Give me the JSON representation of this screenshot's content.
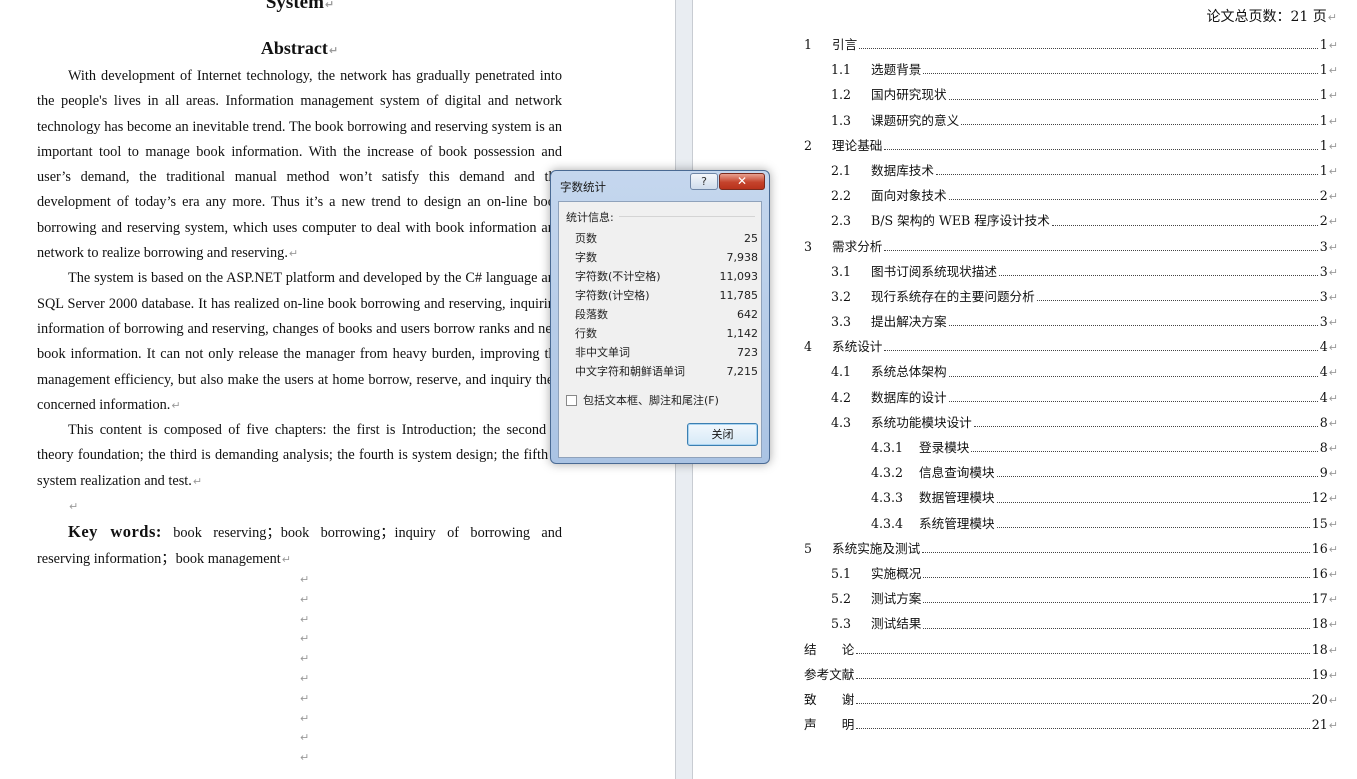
{
  "left_page": {
    "doc_title": "System",
    "abstract_title": "Abstract",
    "para_mark": "↵",
    "paragraphs": [
      "With development of Internet technology, the network has gradually penetrated into the people's lives in all areas. Information management system of digital and network technology has become an inevitable trend. The book borrowing and reserving system is an important tool to manage book information. With the increase of book possession and user’s demand, the traditional manual method won’t satisfy this demand and the development of today’s era any more. Thus it’s a new trend to design an on-line book borrowing and reserving system, which uses computer to deal with book information and network to realize borrowing and reserving.",
      "The system is based on the ASP.NET platform and developed by the C# language and SQL Server 2000 database. It has realized on-line book borrowing and reserving, inquiring information of borrowing and reserving, changes of books and users borrow ranks and new book information. It can not only release the manager from heavy burden, improving the management efficiency, but also make the users at home borrow, reserve, and inquiry their concerned information.",
      "This content is composed of five chapters: the first is Introduction; the second is theory foundation; the third is demanding analysis; the fourth is system design; the fifth is system realization and test."
    ],
    "keywords_label": "Key words:",
    "keywords_text": " book reserving；book borrowing；inquiry of borrowing and reserving information；book management"
  },
  "right_page": {
    "total_pages": "论文总页数：21 页",
    "toc": [
      {
        "num": "1",
        "title": "引言",
        "page": "1",
        "level": 1
      },
      {
        "num": "1.1",
        "title": "选题背景",
        "page": "1",
        "level": 2
      },
      {
        "num": "1.2",
        "title": "国内研究现状",
        "page": "1",
        "level": 2
      },
      {
        "num": "1.3",
        "title": "课题研究的意义",
        "page": "1",
        "level": 2
      },
      {
        "num": "2",
        "title": "理论基础",
        "page": "1",
        "level": 1
      },
      {
        "num": "2.1",
        "title": "数据库技术",
        "page": "1",
        "level": 2
      },
      {
        "num": "2.2",
        "title": "面向对象技术",
        "page": "2",
        "level": 2
      },
      {
        "num": "2.3",
        "title": "B/S 架构的 WEB 程序设计技术",
        "page": "2",
        "level": 2
      },
      {
        "num": "3",
        "title": "需求分析",
        "page": "3",
        "level": 1
      },
      {
        "num": "3.1",
        "title": "图书订阅系统现状描述",
        "page": "3",
        "level": 2
      },
      {
        "num": "3.2",
        "title": "现行系统存在的主要问题分析",
        "page": "3",
        "level": 2
      },
      {
        "num": "3.3",
        "title": "提出解决方案",
        "page": "3",
        "level": 2
      },
      {
        "num": "4",
        "title": "系统设计",
        "page": "4",
        "level": 1
      },
      {
        "num": "4.1",
        "title": "系统总体架构",
        "page": "4",
        "level": 2
      },
      {
        "num": "4.2",
        "title": "数据库的设计",
        "page": "4",
        "level": 2
      },
      {
        "num": "4.3",
        "title": "系统功能模块设计",
        "page": "8",
        "level": 2
      },
      {
        "num": "4.3.1",
        "title": "登录模块",
        "page": "8",
        "level": 3
      },
      {
        "num": "4.3.2",
        "title": "信息查询模块",
        "page": "9",
        "level": 3
      },
      {
        "num": "4.3.3",
        "title": "数据管理模块",
        "page": "12",
        "level": 3
      },
      {
        "num": "4.3.4",
        "title": "系统管理模块",
        "page": "15",
        "level": 3
      },
      {
        "num": "5",
        "title": "系统实施及测试",
        "page": "16",
        "level": 1
      },
      {
        "num": "5.1",
        "title": "实施概况",
        "page": "16",
        "level": 2
      },
      {
        "num": "5.2",
        "title": "测试方案",
        "page": "17",
        "level": 2
      },
      {
        "num": "5.3",
        "title": "测试结果",
        "page": "18",
        "level": 2
      },
      {
        "num": "",
        "title": "结　　论",
        "page": "18",
        "level": 0
      },
      {
        "num": "",
        "title": "参考文献",
        "page": "19",
        "level": 0
      },
      {
        "num": "",
        "title": "致　　谢",
        "page": "20",
        "level": 0
      },
      {
        "num": "",
        "title": "声　　明",
        "page": "21",
        "level": 0
      }
    ]
  },
  "dialog": {
    "title": "字数统计",
    "help": "?",
    "close_x": "✕",
    "section_label": "统计信息:",
    "stats": [
      {
        "label": "页数",
        "value": "25"
      },
      {
        "label": "字数",
        "value": "7,938"
      },
      {
        "label": "字符数(不计空格)",
        "value": "11,093"
      },
      {
        "label": "字符数(计空格)",
        "value": "11,785"
      },
      {
        "label": "段落数",
        "value": "642"
      },
      {
        "label": "行数",
        "value": "1,142"
      },
      {
        "label": "非中文单词",
        "value": "723"
      },
      {
        "label": "中文字符和朝鲜语单词",
        "value": "7,215"
      }
    ],
    "checkbox_label": "包括文本框、脚注和尾注(F)",
    "close_button": "关闭"
  }
}
